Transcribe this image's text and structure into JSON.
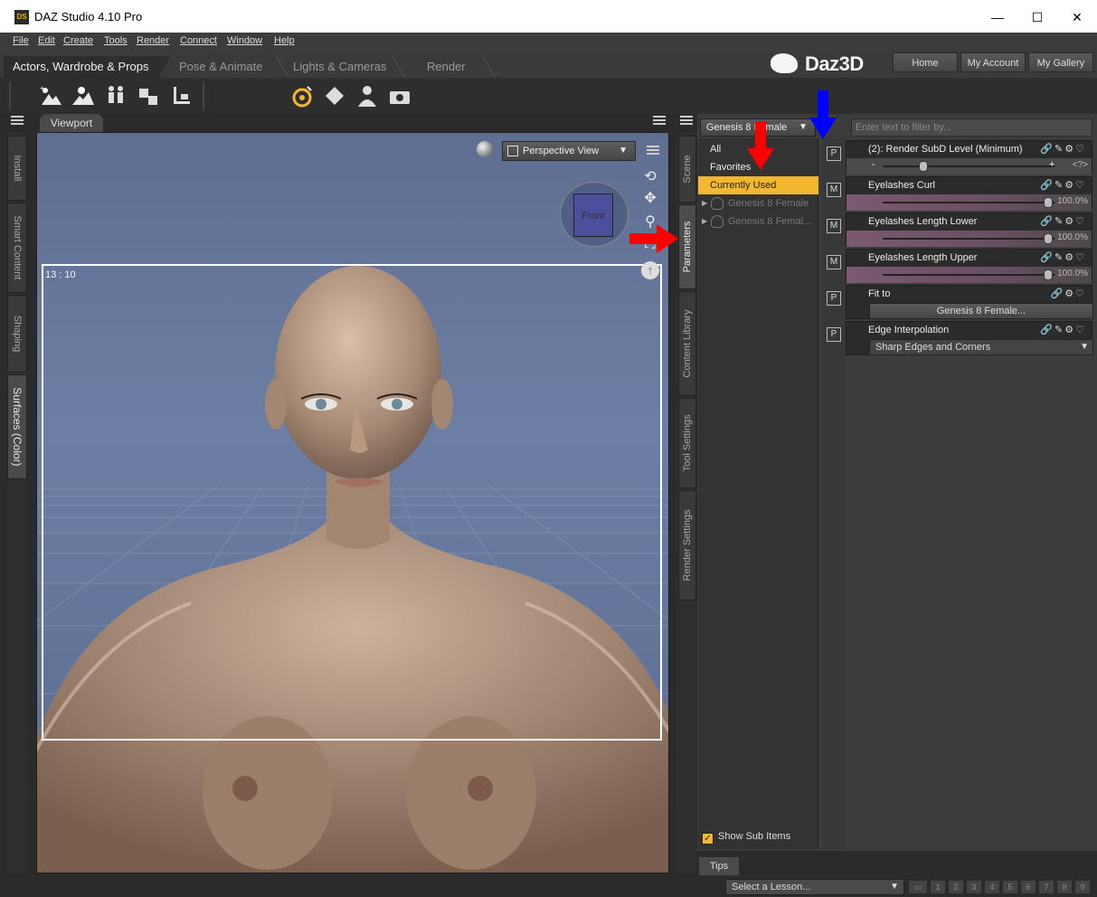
{
  "window": {
    "title": "DAZ Studio 4.10 Pro",
    "icon_text": "DS",
    "minimize": "—",
    "maximize": "☐",
    "close": "✕"
  },
  "menu": [
    "File",
    "Edit",
    "Create",
    "Tools",
    "Render",
    "Connect",
    "Window",
    "Help"
  ],
  "pane_tabs": [
    "Actors, Wardrobe & Props",
    "Pose & Animate",
    "Lights & Cameras",
    "Render"
  ],
  "brand": {
    "logo": "Daz3D",
    "nav": [
      "Home",
      "My Account",
      "My Gallery"
    ]
  },
  "left_tabs": [
    "Install",
    "Smart Content",
    "Shaping",
    "Surfaces (Color)"
  ],
  "viewport": {
    "tab_label": "Viewport",
    "camera": "Perspective View",
    "aspect_label": "13 : 10",
    "cube_label": "Front"
  },
  "middle_tabs": [
    "Scene",
    "Parameters",
    "Content Library",
    "Tool Settings",
    "Render Settings"
  ],
  "parameters": {
    "node": "Genesis 8 Female",
    "filter_placeholder": "Enter text to filter by...",
    "categories": [
      "All",
      "Favorites",
      "Currently Used"
    ],
    "sub_nodes": [
      "Genesis 8 Female",
      "Genesis 8 Femal..."
    ],
    "show_sub_items": "Show Sub Items",
    "properties": [
      {
        "tag": "P",
        "name": "(2): Render SubD Level (Minimum)",
        "type": "int",
        "value": "<?>",
        "minus": "-",
        "plus": "+",
        "level": 0.23
      },
      {
        "tag": "M",
        "name": "Eyelashes Curl",
        "type": "morph",
        "value": "100.0%",
        "level": 1.0
      },
      {
        "tag": "M",
        "name": "Eyelashes Length Lower",
        "type": "morph",
        "value": "100.0%",
        "level": 1.0
      },
      {
        "tag": "M",
        "name": "Eyelashes Length Upper",
        "type": "morph",
        "value": "100.0%",
        "level": 1.0
      },
      {
        "tag": "P",
        "name": "Fit to",
        "type": "button",
        "value": "Genesis 8 Female..."
      },
      {
        "tag": "P",
        "name": "Edge Interpolation",
        "type": "select",
        "value": "Sharp Edges and Corners"
      }
    ]
  },
  "bottom": {
    "tips_tab": "Tips",
    "lesson_placeholder": "Select a Lesson...",
    "steps": [
      "1",
      "2",
      "3",
      "4",
      "5",
      "6",
      "7",
      "8",
      "9"
    ]
  },
  "colors": {
    "selected": "#f3b830",
    "annotation_red": "#ff0000",
    "annotation_blue": "#0000ff"
  }
}
